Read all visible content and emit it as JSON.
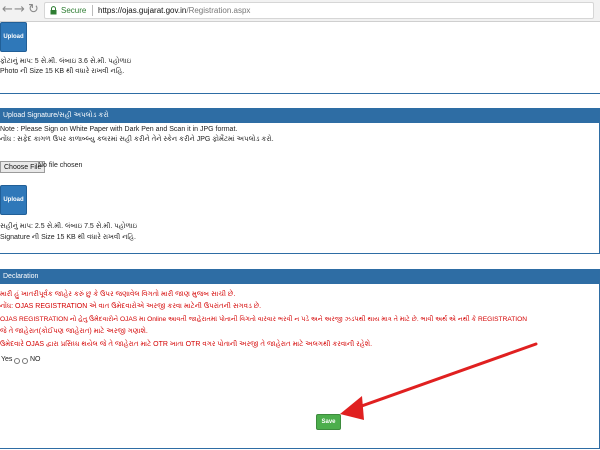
{
  "browser": {
    "back_icon": "←",
    "forward_icon": "→",
    "reload_icon": "↻",
    "secure_label": "Secure",
    "url_host": "https://ojas.gujarat.gov.in",
    "url_path": "/Registration.aspx"
  },
  "photo_section": {
    "upload_label": "Upload",
    "size_text": "ફોટાનું માપ: 5 સે.મી. લંબાઇ 3.6 સે.મી. પહોળાઇ",
    "size_limit_text": "Photo ની Size 15 KB થી વધારે રાખવી નહિ."
  },
  "signature_section": {
    "heading": "Upload Signature/સહી અપલોડ કરો",
    "note_en": "Note : Please Sign on White Paper with Dark Pen and Scan it in JPG format.",
    "note_gu": "નોંધ : સફેદ કાગળ ઉપર કાળાબ્લ્યુ કલરમાં સહી કરીને તેને સ્કેન કરીને JPG ફોર્મેટમાં અપલોડ કરો.",
    "choose_label": "Choose File",
    "no_file_text": "No file chosen",
    "upload_label": "Upload",
    "size_text": "સહીનું માપ: 2.5 સે.મી. લંબાઇ 7.5 સે.મી. પહોળાઇ",
    "size_limit_text": "Signature ની Size 15 KB થી વધારે રાખવી નહિ."
  },
  "declaration": {
    "heading": "Declaration",
    "lines": [
      "મારી હું ખાતરીપૂર્વક જાહેર કરું છુ કે ઉપર જણાવેલ વિગતો મારી જાણ મુજબ સાચી છે.",
      "નોંધ: OJAS REGISTRATION એ વાત ઉમેદવારોએ અરજી કરવા માટેની ઉપરાંતની સગવડ છે.",
      "OJAS REGISTRATION નો હેતુ ઉમેદવારોને OJAS મા Online આવતી જાહેરાતમાં પોતાની વિગતો વારંવાર ભરવી ન પડે અને અરજી ઝડપથી થાય માત્ર તે માટે છે. ભાવી અર્થ એ નથી કે REGISTRATION",
      "જે તે જાહેરાત(કોઈપણ જાહેરાત) માટે અરજી ગણાશે.",
      "ઉમેદવારે OJAS દ્વારા પ્રસિધ્ધ થયેલ જે તે જાહેરાત માટે OTR ખાતા OTR વગર પોતાની અરજી તે જાહેરાત માટે અલગથી કરવાની રહેશે."
    ],
    "yes_label": "Yes",
    "no_label": "NO"
  },
  "save_label": "Save",
  "colors": {
    "panel_blue": "#2e6da4",
    "upload_blue": "#2f78b9",
    "declaration_red": "#d40000",
    "save_green": "#4cae4c",
    "annotation_arrow": "#e02020"
  }
}
